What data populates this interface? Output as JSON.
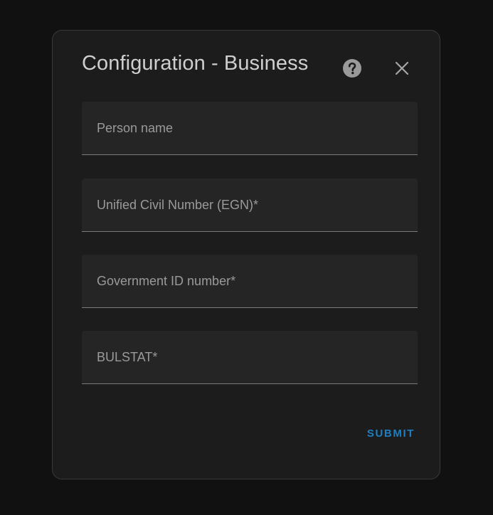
{
  "dialog": {
    "title": "Configuration - Business",
    "fields": [
      {
        "label": "Person name"
      },
      {
        "label": "Unified Civil Number (EGN)*"
      },
      {
        "label": "Government ID number*"
      },
      {
        "label": "BULSTAT*"
      }
    ],
    "submit_label": "SUBMIT"
  },
  "icons": {
    "help": "help-circle-icon",
    "close": "close-icon"
  },
  "colors": {
    "page_background": "#111111",
    "dialog_background": "#1c1c1c",
    "field_background": "#252525",
    "accent": "#1e7fc0",
    "title_text": "#cfcfcf",
    "label_text": "#9a9a9a"
  }
}
